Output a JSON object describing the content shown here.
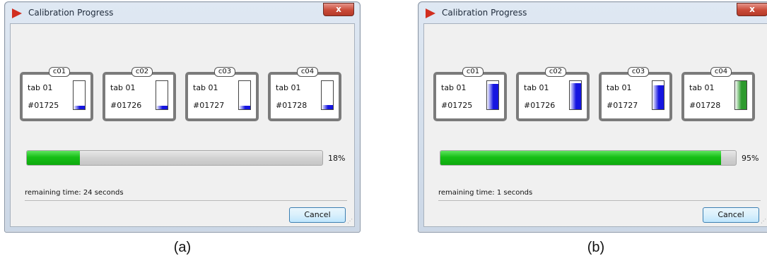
{
  "panels": [
    {
      "caption": "(a)",
      "window": {
        "title": "Calibration Progress",
        "close_label": "x"
      },
      "slots": [
        {
          "tag": "c01",
          "line1": "tab 01",
          "line2": "#01725",
          "level": 0.12,
          "color": "blue"
        },
        {
          "tag": "c02",
          "line1": "tab 01",
          "line2": "#01726",
          "level": 0.12,
          "color": "blue"
        },
        {
          "tag": "c03",
          "line1": "tab 01",
          "line2": "#01727",
          "level": 0.12,
          "color": "blue"
        },
        {
          "tag": "c04",
          "line1": "tab 01",
          "line2": "#01728",
          "level": 0.14,
          "color": "blue"
        }
      ],
      "progress": {
        "value": 0.18,
        "label": "18%"
      },
      "remaining": "remaining time: 24 seconds",
      "cancel_label": "Cancel"
    },
    {
      "caption": "(b)",
      "window": {
        "title": "Calibration Progress",
        "close_label": "x"
      },
      "slots": [
        {
          "tag": "c01",
          "line1": "tab 01",
          "line2": "#01725",
          "level": 0.9,
          "color": "blue"
        },
        {
          "tag": "c02",
          "line1": "tab 01",
          "line2": "#01726",
          "level": 0.92,
          "color": "blue"
        },
        {
          "tag": "c03",
          "line1": "tab 01",
          "line2": "#01727",
          "level": 0.85,
          "color": "blue"
        },
        {
          "tag": "c04",
          "line1": "tab 01",
          "line2": "#01728",
          "level": 1.0,
          "color": "green"
        }
      ],
      "progress": {
        "value": 0.95,
        "label": "95%"
      },
      "remaining": "remaining time: 1 seconds",
      "cancel_label": "Cancel"
    }
  ],
  "colors": {
    "blue_meter": "#1515e0",
    "green_meter": "#2e9a2e",
    "progress_green": "#16bf16",
    "accent_red": "#c0392b"
  }
}
